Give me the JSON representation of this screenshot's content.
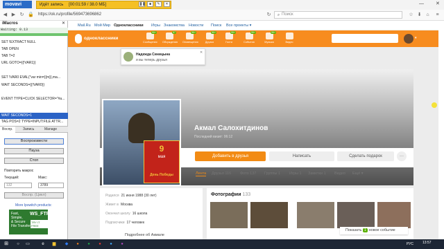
{
  "recording": {
    "brand": "movavi",
    "status": "Идёт запись",
    "time_size": "[00:01:59 / 38.0 MБ]"
  },
  "browser": {
    "url": "https://ok.ru/profile/569473696862",
    "search_placeholder": "Поиск"
  },
  "imacros": {
    "title": "iMacros",
    "status": "Waiting: 0.13",
    "script_lines": [
      "SET !EXTRACT NULL",
      "TAB OPEN",
      "TAB T=2",
      "URL GOTO={{!VAR1}}",
      "",
      "SET !VAR0 EVAL(\"var min={{m}},ma...",
      "WAIT SECONDS={{!VAR0}}",
      "",
      "EVENT TYPE=CLICK SELECTOR=\"#a...",
      "",
      "WAIT SECONDS=1",
      "TAG POS=2 TYPE=INPUT:FILE ATTR..."
    ],
    "tabs": [
      "Воспр.",
      "Запись",
      "Manage"
    ],
    "buttons": {
      "play": "Воспроизвести",
      "pause": "Пауза",
      "stop": "Стоп",
      "play_loop": "Воспр. (Цикл)"
    },
    "repeat_label": "Повторить макрос",
    "current_label": "Текущий:",
    "max_label": "Макс:",
    "current_value": "132",
    "max_value": "3789",
    "more_products": "More Ipswitch products:",
    "ad": {
      "line1": "Fast,",
      "line2": "Simple,",
      "line3": "& Secure",
      "line4": "File Transfer",
      "brand": "WS_FTP",
      "cta": "TRY IT FREE"
    }
  },
  "ok_menu": [
    "Mail.Ru",
    "Мой Мир",
    "Одноклассники",
    "Игры",
    "Знакомства",
    "Новости",
    "Поиск",
    "Все проекты ▾"
  ],
  "ok_header": {
    "logo": "одноклассники",
    "nav": [
      {
        "label": "Сообщения",
        "badge": "99+"
      },
      {
        "label": "Обсуждения",
        "badge": "57"
      },
      {
        "label": "Оповещения",
        "badge": "99+"
      },
      {
        "label": "Друзья",
        "badge": "99+"
      },
      {
        "label": "Гости",
        "badge": "99+"
      },
      {
        "label": "События",
        "badge": "99+"
      },
      {
        "label": "Музыка",
        "badge": "99+"
      },
      {
        "label": "Видео",
        "badge": ""
      }
    ]
  },
  "notification": {
    "name": "Надежда Синицына",
    "text": "и вы теперь друзья"
  },
  "profile": {
    "name": "Акмал Салохитдинов",
    "last_visit": "Последний визит: 06:12",
    "add_friend": "Добавить в друзья",
    "write": "Написать",
    "gift": "Сделать подарок",
    "more": "···",
    "badge_line1": "9",
    "badge_line2": "мая",
    "badge_line3": "День Победы",
    "tabs": [
      "Лента",
      "Друзья 116",
      "Фото 137",
      "Группы 1",
      "Игры 1",
      "Заметки 1",
      "Видео",
      "Ещё ▾"
    ]
  },
  "info": {
    "rows": [
      {
        "label": "Родился",
        "value": "21 июня 1988 (30 лет)"
      },
      {
        "label": "Живет в",
        "value": "Москва"
      },
      {
        "label": "Окончил школу",
        "value": "16 школа"
      },
      {
        "label": "Подписчики",
        "value": "17 человек"
      }
    ],
    "more": "Подробнее об Акмале"
  },
  "photos": {
    "title": "Фотографии",
    "count": "133",
    "show_label": "Показать",
    "show_count": "1",
    "show_suffix": "новое событие"
  },
  "taskbar": {
    "lang": "РУС",
    "time": "13:57"
  }
}
